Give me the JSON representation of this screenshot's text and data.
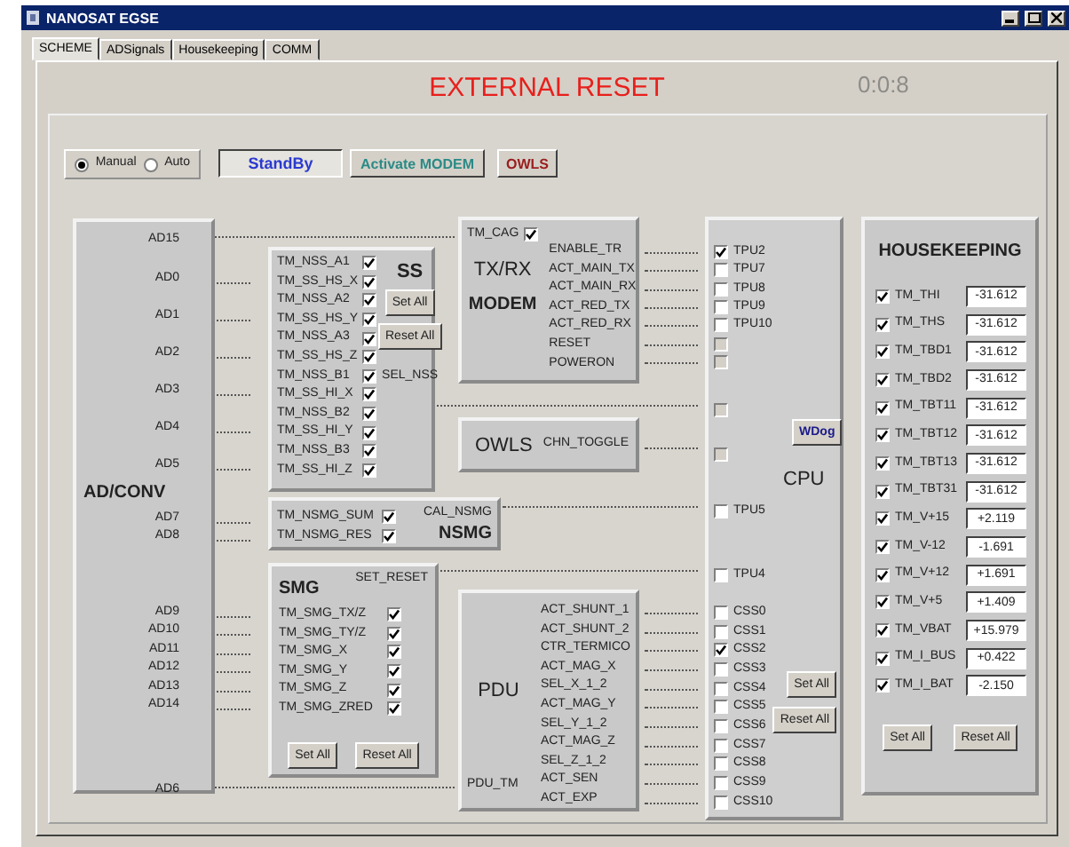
{
  "window": {
    "title": "NANOSAT EGSE"
  },
  "tabs": [
    {
      "label": "SCHEME",
      "selected": true
    },
    {
      "label": "ADSignals",
      "selected": false
    },
    {
      "label": "Housekeeping",
      "selected": false
    },
    {
      "label": "COMM",
      "selected": false
    }
  ],
  "header": {
    "title": "EXTERNAL RESET",
    "timer": "0:0:8"
  },
  "mode": [
    {
      "label": "Manual",
      "selected": true
    },
    {
      "label": "Auto",
      "selected": false
    }
  ],
  "status": "StandBy",
  "actions": [
    {
      "label": "Activate MODEM",
      "kind": "modem"
    },
    {
      "label": "OWLS",
      "kind": "owls"
    }
  ],
  "ad_conv": {
    "title": "AD/CONV",
    "ports": [
      "AD15",
      "AD0",
      "AD1",
      "AD2",
      "AD3",
      "AD4",
      "AD5",
      "AD7",
      "AD8",
      "AD9",
      "AD10",
      "AD11",
      "AD12",
      "AD13",
      "AD14",
      "AD6"
    ]
  },
  "ss": {
    "title": "SS",
    "output": "SEL_NSS",
    "buttons": [
      "Set All",
      "Reset All"
    ],
    "channels": [
      {
        "label": "TM_NSS_A1",
        "checked": true
      },
      {
        "label": "TM_SS_HS_X",
        "checked": true
      },
      {
        "label": "TM_NSS_A2",
        "checked": true
      },
      {
        "label": "TM_SS_HS_Y",
        "checked": true
      },
      {
        "label": "TM_NSS_A3",
        "checked": true
      },
      {
        "label": "TM_SS_HS_Z",
        "checked": true
      },
      {
        "label": "TM_NSS_B1",
        "checked": true
      },
      {
        "label": "TM_SS_HI_X",
        "checked": true
      },
      {
        "label": "TM_NSS_B2",
        "checked": true
      },
      {
        "label": "TM_SS_HI_Y",
        "checked": true
      },
      {
        "label": "TM_NSS_B3",
        "checked": true
      },
      {
        "label": "TM_SS_HI_Z",
        "checked": true
      }
    ]
  },
  "txrx": {
    "title": "TX/RX",
    "subtitle": "MODEM",
    "cag": {
      "label": "TM_CAG",
      "checked": true
    },
    "signals": [
      "ENABLE_TR",
      "ACT_MAIN_TX",
      "ACT_MAIN_RX",
      "ACT_RED_TX",
      "ACT_RED_RX",
      "RESET",
      "POWERON"
    ]
  },
  "owls": {
    "title": "OWLS",
    "signal": "CHN_TOGGLE"
  },
  "nsmg": {
    "title": "NSMG",
    "output": "CAL_NSMG",
    "channels": [
      {
        "label": "TM_NSMG_SUM",
        "checked": true
      },
      {
        "label": "TM_NSMG_RES",
        "checked": true
      }
    ]
  },
  "smg": {
    "title": "SMG",
    "output": "SET_RESET",
    "buttons": [
      "Set All",
      "Reset All"
    ],
    "channels": [
      {
        "label": "TM_SMG_TX/Z",
        "checked": true
      },
      {
        "label": "TM_SMG_TY/Z",
        "checked": true
      },
      {
        "label": "TM_SMG_X",
        "checked": true
      },
      {
        "label": "TM_SMG_Y",
        "checked": true
      },
      {
        "label": "TM_SMG_Z",
        "checked": true
      },
      {
        "label": "TM_SMG_ZRED",
        "checked": true
      }
    ]
  },
  "pdu": {
    "title": "PDU",
    "tm": "PDU_TM",
    "signals": [
      "ACT_SHUNT_1",
      "ACT_SHUNT_2",
      "CTR_TERMICO",
      "ACT_MAG_X",
      "SEL_X_1_2",
      "ACT_MAG_Y",
      "SEL_Y_1_2",
      "ACT_MAG_Z",
      "SEL_Z_1_2",
      "ACT_SEN",
      "ACT_EXP"
    ]
  },
  "cpu": {
    "title": "CPU",
    "watchdog": "WDog",
    "buttons": [
      "Set All",
      "Reset All"
    ],
    "pins": [
      {
        "label": "TPU2",
        "checked": true,
        "disabled": false
      },
      {
        "label": "TPU7",
        "checked": false,
        "disabled": false
      },
      {
        "label": "TPU8",
        "checked": false,
        "disabled": false
      },
      {
        "label": "TPU9",
        "checked": false,
        "disabled": false
      },
      {
        "label": "TPU10",
        "checked": false,
        "disabled": false
      },
      {
        "checked": false,
        "disabled": true
      },
      {
        "checked": false,
        "disabled": true
      },
      {
        "checked": false,
        "disabled": true
      },
      {
        "checked": false,
        "disabled": true
      },
      {
        "label": "TPU5",
        "checked": false,
        "disabled": false
      },
      {
        "label": "TPU4",
        "checked": false,
        "disabled": false
      },
      {
        "label": "CSS0",
        "checked": false,
        "disabled": false
      },
      {
        "label": "CSS1",
        "checked": false,
        "disabled": false
      },
      {
        "label": "CSS2",
        "checked": true,
        "disabled": false
      },
      {
        "label": "CSS3",
        "checked": false,
        "disabled": false
      },
      {
        "label": "CSS4",
        "checked": false,
        "disabled": false
      },
      {
        "label": "CSS5",
        "checked": false,
        "disabled": false
      },
      {
        "label": "CSS6",
        "checked": false,
        "disabled": false
      },
      {
        "label": "CSS7",
        "checked": false,
        "disabled": false
      },
      {
        "label": "CSS8",
        "checked": false,
        "disabled": false
      },
      {
        "label": "CSS9",
        "checked": false,
        "disabled": false
      },
      {
        "label": "CSS10",
        "checked": false,
        "disabled": false
      }
    ]
  },
  "housekeeping": {
    "title": "HOUSEKEEPING",
    "buttons": [
      "Set All",
      "Reset All"
    ],
    "channels": [
      {
        "label": "TM_THI",
        "checked": true,
        "value": "-31.612"
      },
      {
        "label": "TM_THS",
        "checked": true,
        "value": "-31.612"
      },
      {
        "label": "TM_TBD1",
        "checked": true,
        "value": "-31.612"
      },
      {
        "label": "TM_TBD2",
        "checked": true,
        "value": "-31.612"
      },
      {
        "label": "TM_TBT11",
        "checked": true,
        "value": "-31.612"
      },
      {
        "label": "TM_TBT12",
        "checked": true,
        "value": "-31.612"
      },
      {
        "label": "TM_TBT13",
        "checked": true,
        "value": "-31.612"
      },
      {
        "label": "TM_TBT31",
        "checked": true,
        "value": "-31.612"
      },
      {
        "label": "TM_V+15",
        "checked": true,
        "value": "+2.119"
      },
      {
        "label": "TM_V-12",
        "checked": true,
        "value": "-1.691"
      },
      {
        "label": "TM_V+12",
        "checked": true,
        "value": "+1.691"
      },
      {
        "label": "TM_V+5",
        "checked": true,
        "value": "+1.409"
      },
      {
        "label": "TM_VBAT",
        "checked": true,
        "value": "+15.979"
      },
      {
        "label": "TM_I_BUS",
        "checked": true,
        "value": "+0.422"
      },
      {
        "label": "TM_I_BAT",
        "checked": true,
        "value": "-2.150"
      }
    ]
  }
}
